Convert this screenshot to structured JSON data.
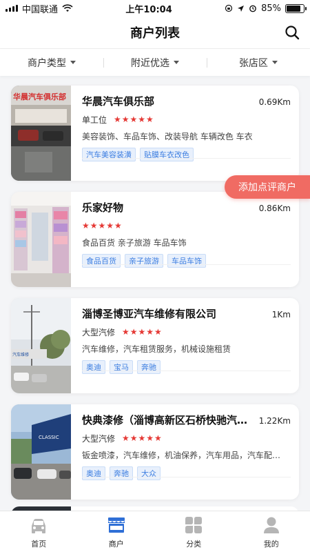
{
  "status_bar": {
    "carrier": "中国联通",
    "time": "上午10:04",
    "battery": "85%",
    "battery_level": 0.85
  },
  "header": {
    "title": "商户列表",
    "search_icon": "search-icon"
  },
  "filters": [
    {
      "label": "商户类型"
    },
    {
      "label": "附近优选"
    },
    {
      "label": "张店区"
    }
  ],
  "merchants": [
    {
      "name": "华晨汽车俱乐部",
      "distance": "0.69Km",
      "type": "单工位",
      "stars": "★★★★★",
      "rating": 5,
      "description": "美容装饰、车品车饰、改装导航 车辆改色 车衣",
      "tags": [
        "汽车美容装潢",
        "贴膜车衣改色"
      ]
    },
    {
      "name": "乐家好物",
      "distance": "0.86Km",
      "type": "",
      "stars": "★★★★★",
      "rating": 5,
      "description": "食品百货 亲子旅游 车品车饰",
      "tags": [
        "食品百货",
        "亲子旅游",
        "车品车饰"
      ]
    },
    {
      "name": "淄博圣博亚汽车维修有限公司",
      "distance": "1Km",
      "type": "大型汽修",
      "stars": "★★★★★",
      "rating": 5,
      "description": "汽车维修，汽车租赁服务，机械设施租赁",
      "tags": [
        "奥迪",
        "宝马",
        "奔驰"
      ]
    },
    {
      "name": "快典漆修（淄博高新区石桥快驰汽车服务中心）",
      "distance": "1.22Km",
      "type": "大型汽修",
      "stars": "★★★★★",
      "rating": 5,
      "description": "钣金喷漆，汽车维修，机油保养，汽车用品，汽车配件，汽车美容",
      "tags": [
        "奥迪",
        "奔驰",
        "大众"
      ]
    }
  ],
  "fab": {
    "label": "添加点评商户"
  },
  "tabs": [
    {
      "label": "首页",
      "icon": "car-icon",
      "active": false
    },
    {
      "label": "商户",
      "icon": "shop-icon",
      "active": true
    },
    {
      "label": "分类",
      "icon": "category-icon",
      "active": false
    },
    {
      "label": "我的",
      "icon": "user-icon",
      "active": false
    }
  ],
  "colors": {
    "accent": "#3d7ee0",
    "fab": "#f06b63",
    "stars": "#e53935",
    "tab_active": "#2f6fd6",
    "tab_inactive": "#b5b5b5"
  }
}
